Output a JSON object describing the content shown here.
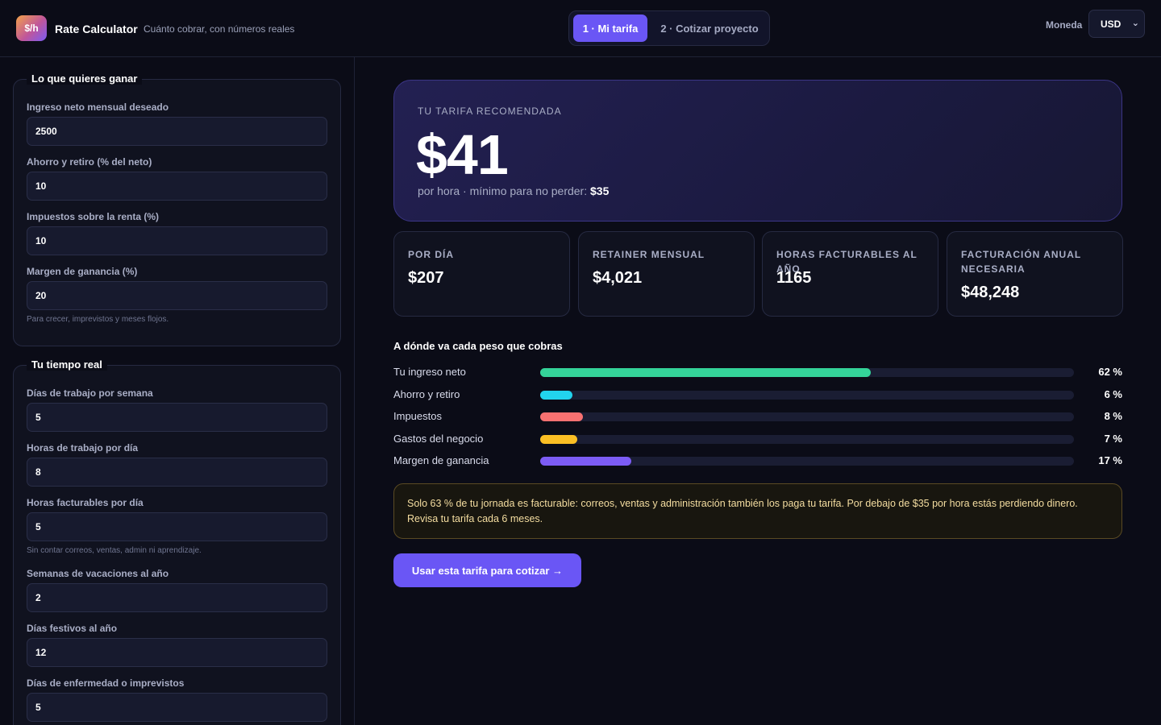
{
  "header": {
    "logo_text": "$/h",
    "title": "Rate Calculator",
    "subtitle": "Cuánto cobrar, con números reales",
    "tabs": [
      {
        "label": "1 · Mi tarifa",
        "active": true
      },
      {
        "label": "2 · Cotizar proyecto",
        "active": false
      }
    ],
    "currency_label": "Moneda",
    "currency_value": "USD"
  },
  "sidebar": {
    "group1": {
      "legend": "Lo que quieres ganar",
      "fields": [
        {
          "label": "Ingreso neto mensual deseado",
          "value": "2500"
        },
        {
          "label": "Ahorro y retiro (% del neto)",
          "value": "10"
        },
        {
          "label": "Impuestos sobre la renta (%)",
          "value": "10"
        },
        {
          "label": "Margen de ganancia (%)",
          "value": "20"
        }
      ],
      "hint": "Para crecer, imprevistos y meses flojos."
    },
    "group2": {
      "legend": "Tu tiempo real",
      "fields": [
        {
          "label": "Días de trabajo por semana",
          "value": "5"
        },
        {
          "label": "Horas de trabajo por día",
          "value": "8"
        },
        {
          "label": "Horas facturables por día",
          "value": "5"
        },
        {
          "label": "Semanas de vacaciones al año",
          "value": "2"
        },
        {
          "label": "Días festivos al año",
          "value": "12"
        },
        {
          "label": "Días de enfermedad o imprevistos",
          "value": "5"
        }
      ],
      "hint": "Sin contar correos, ventas, admin ni aprendizaje."
    }
  },
  "hero": {
    "kicker": "TU TARIFA RECOMENDADA",
    "rate": "$41",
    "sub_prefix": "por hora · mínimo para no perder: ",
    "min_rate": "$35"
  },
  "stats": [
    {
      "label": "POR DÍA",
      "value": "$207"
    },
    {
      "label": "RETAINER MENSUAL",
      "value": "$4,021"
    },
    {
      "label": "HORAS FACTURABLES AL AÑO",
      "value": "1165"
    },
    {
      "label": "FACTURACIÓN ANUAL NECESARIA",
      "value": "$48,248"
    }
  ],
  "breakdown": {
    "title": "A dónde va cada peso que cobras",
    "rows": [
      {
        "label": "Tu ingreso neto",
        "pct": 62,
        "pct_text": "62 %",
        "color": "#34d399"
      },
      {
        "label": "Ahorro y retiro",
        "pct": 6,
        "pct_text": "6 %",
        "color": "#22d3ee"
      },
      {
        "label": "Impuestos",
        "pct": 8,
        "pct_text": "8 %",
        "color": "#f87171"
      },
      {
        "label": "Gastos del negocio",
        "pct": 7,
        "pct_text": "7 %",
        "color": "#fbbf24"
      },
      {
        "label": "Margen de ganancia",
        "pct": 17,
        "pct_text": "17 %",
        "color": "#7c5cf5"
      }
    ]
  },
  "notice": "Solo 63 % de tu jornada es facturable: correos, ventas y administración también los paga tu tarifa. Por debajo de $35 por hora estás perdiendo dinero. Revisa tu tarifa cada 6 meses.",
  "cta_label": "Usar esta tarifa para cotizar →"
}
